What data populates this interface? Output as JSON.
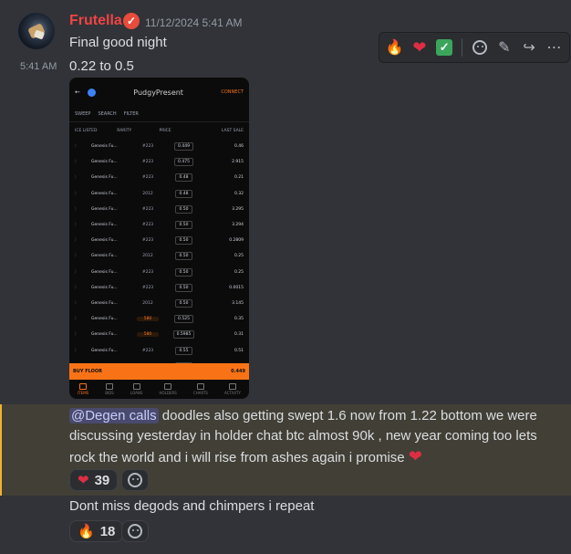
{
  "message": {
    "username": "Frutella",
    "timestamp": "11/12/2024 5:41 AM",
    "side_time": "5:41 AM",
    "line1": "Final good night",
    "line2": "0.22 to 0.5"
  },
  "toolbar": {
    "icons": [
      "fire-emoji",
      "heart-emoji",
      "check-emoji",
      "add-reaction-icon",
      "edit-icon",
      "forward-icon",
      "more-icon"
    ],
    "fire": "🔥",
    "heart": "❤",
    "check": "✓",
    "edit": "✎",
    "forward": "↪",
    "more": "⋯"
  },
  "embed": {
    "title": "PudgyPresent",
    "connect": "CONNECT",
    "sweep": "SWEEP",
    "search": "SEARCH",
    "filter": "FILTER",
    "headers": [
      "ICE LISTED",
      "RARITY",
      "PRICE",
      "LAST SALE"
    ],
    "rows": [
      {
        "name": "Genesis Fu...",
        "rarity": "#223",
        "price": "0.449",
        "last": "0.46"
      },
      {
        "name": "Genesis Fu...",
        "rarity": "#223",
        "price": "0.475",
        "last": "2.915"
      },
      {
        "name": "Genesis Fu...",
        "rarity": "#223",
        "price": "0.48",
        "last": "0.21"
      },
      {
        "name": "Genesis Fu...",
        "rarity": "2012",
        "price": "0.48",
        "last": "0.32"
      },
      {
        "name": "Genesis Fu...",
        "rarity": "#223",
        "price": "0.50",
        "last": "3.295"
      },
      {
        "name": "Genesis Fu...",
        "rarity": "#223",
        "price": "0.50",
        "last": "3.294"
      },
      {
        "name": "Genesis Fu...",
        "rarity": "#223",
        "price": "0.50",
        "last": "0.2809"
      },
      {
        "name": "Genesis Fu...",
        "rarity": "2012",
        "price": "0.50",
        "last": "0.25"
      },
      {
        "name": "Genesis Fu...",
        "rarity": "#223",
        "price": "0.50",
        "last": "0.25"
      },
      {
        "name": "Genesis Fu...",
        "rarity": "#223",
        "price": "0.50",
        "last": "0.0015"
      },
      {
        "name": "Genesis Fu...",
        "rarity": "2012",
        "price": "0.50",
        "last": "3.145"
      },
      {
        "name": "Genesis Fu...",
        "rarity": "580",
        "price": "0.525",
        "last": "0.35"
      },
      {
        "name": "Genesis Fu...",
        "rarity": "580",
        "price": "0.5985",
        "last": "0.31"
      },
      {
        "name": "Genesis Fu...",
        "rarity": "#223",
        "price": "0.55",
        "last": "0.51"
      },
      {
        "name": "Genesis Fu...",
        "rarity": "580",
        "price": "0.56",
        "last": "0.53"
      }
    ],
    "buy_label": "BUY FLOOR",
    "buy_value": "0.449",
    "nav": [
      "ITEMS",
      "BIDS",
      "LOANS",
      "HOLDERS",
      "CHARTS",
      "ACTIVITY"
    ]
  },
  "mention_message": {
    "mention": "@Degen calls",
    "text": " doodles also getting swept 1.6 now from 1.22 bottom we were discussing yesterday in holder chat btc almost 90k , new year coming too lets rock the world and i will rise from ashes again i promise ",
    "heart": "❤"
  },
  "reactions": {
    "first": {
      "emoji": "❤",
      "count": "39"
    },
    "second": {
      "emoji": "🔥",
      "count": "18"
    }
  },
  "followup": "Dont miss degods and chimpers i repeat"
}
